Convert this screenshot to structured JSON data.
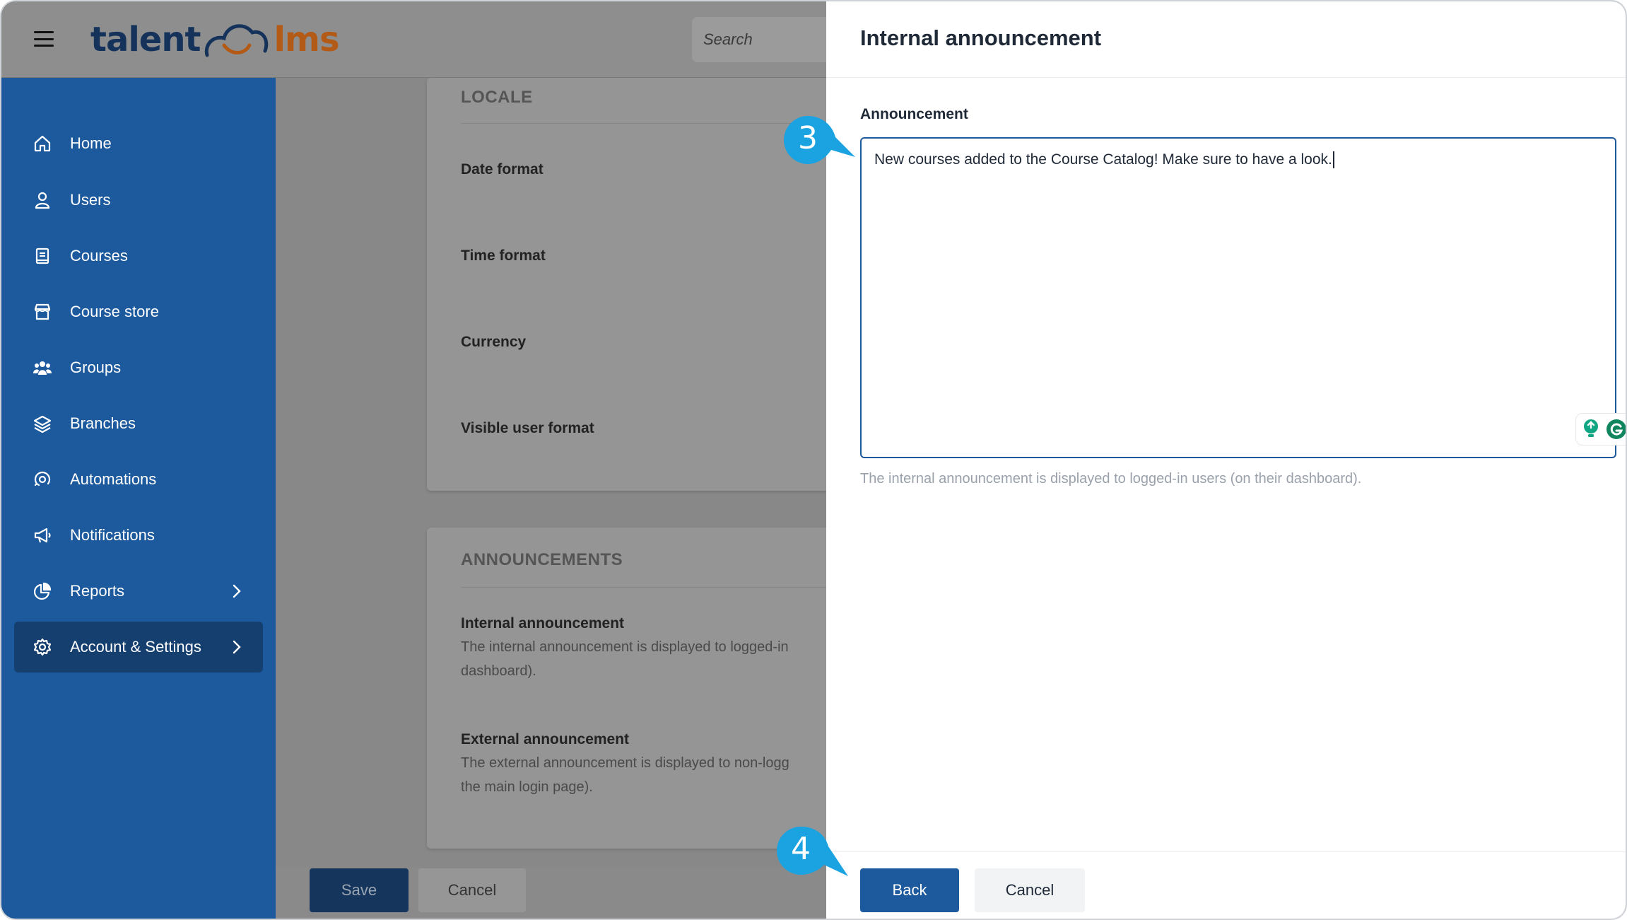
{
  "header": {
    "logo_part1": "talent",
    "logo_part2": "lms",
    "search_placeholder": "Search"
  },
  "sidebar": {
    "items": [
      {
        "label": "Home",
        "icon": "home-icon",
        "active": false,
        "chevron": false
      },
      {
        "label": "Users",
        "icon": "user-icon",
        "active": false,
        "chevron": false
      },
      {
        "label": "Courses",
        "icon": "book-icon",
        "active": false,
        "chevron": false
      },
      {
        "label": "Course store",
        "icon": "store-icon",
        "active": false,
        "chevron": false
      },
      {
        "label": "Groups",
        "icon": "groups-icon",
        "active": false,
        "chevron": false
      },
      {
        "label": "Branches",
        "icon": "layers-icon",
        "active": false,
        "chevron": false
      },
      {
        "label": "Automations",
        "icon": "automation-icon",
        "active": false,
        "chevron": false
      },
      {
        "label": "Notifications",
        "icon": "megaphone-icon",
        "active": false,
        "chevron": false
      },
      {
        "label": "Reports",
        "icon": "pie-chart-icon",
        "active": false,
        "chevron": true
      },
      {
        "label": "Account & Settings",
        "icon": "gear-icon",
        "active": true,
        "chevron": true
      }
    ]
  },
  "main": {
    "locale": {
      "title": "LOCALE",
      "fields": [
        "Date format",
        "Time format",
        "Currency",
        "Visible user format"
      ]
    },
    "announcements": {
      "title": "ANNOUNCEMENTS",
      "internal": {
        "label": "Internal announcement",
        "desc_line1": "The internal announcement is displayed to logged-in",
        "desc_line2": "dashboard)."
      },
      "external": {
        "label": "External announcement",
        "desc_line1": "The external announcement is displayed to non-logg",
        "desc_line2": "the main login page)."
      }
    },
    "footer": {
      "save": "Save",
      "cancel": "Cancel"
    }
  },
  "panel": {
    "title": "Internal announcement",
    "field_label": "Announcement",
    "value": "New courses added to the Course Catalog! Make sure to have a look.",
    "help": "The internal announcement is displayed to logged-in users (on their dashboard).",
    "back": "Back",
    "cancel": "Cancel"
  },
  "callouts": {
    "step3": "3",
    "step4": "4",
    "color": "#1aa3e0"
  },
  "colors": {
    "brand_blue": "#1c5a9d",
    "active_nav": "#153f6f"
  }
}
